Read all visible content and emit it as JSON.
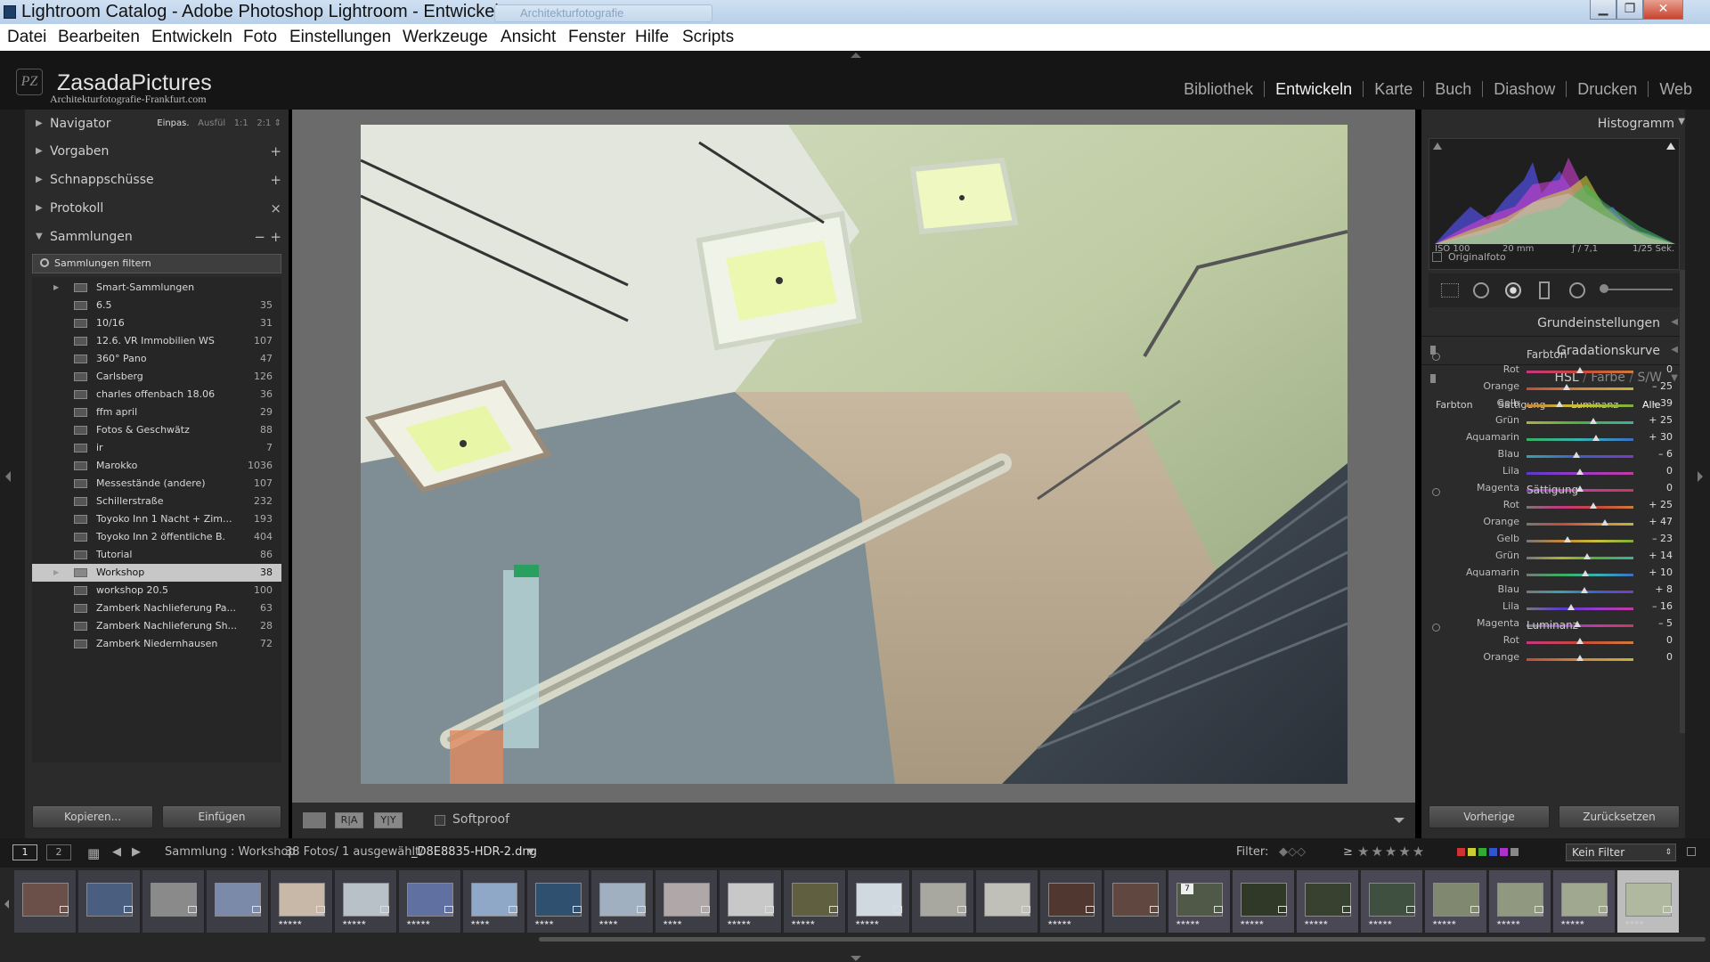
{
  "window": {
    "title": "Lightroom Catalog - Adobe Photoshop Lightroom - Entwickeln",
    "ghost_tab": "Architekturfotografie",
    "minimize": "▁",
    "maximize": "❐",
    "close": "✕"
  },
  "menu": [
    "Datei",
    "Bearbeiten",
    "Entwickeln",
    "Foto",
    "Einstellungen",
    "Werkzeuge",
    "Ansicht",
    "Fenster",
    "Hilfe",
    "Scripts"
  ],
  "brand": {
    "logo": "PZ",
    "name": "ZasadaPictures",
    "subtitle": "Architekturfotografie-Frankfurt.com"
  },
  "modules": [
    {
      "label": "Bibliothek",
      "active": false
    },
    {
      "label": "Entwickeln",
      "active": true
    },
    {
      "label": "Karte",
      "active": false
    },
    {
      "label": "Buch",
      "active": false
    },
    {
      "label": "Diashow",
      "active": false
    },
    {
      "label": "Drucken",
      "active": false
    },
    {
      "label": "Web",
      "active": false
    }
  ],
  "left": {
    "navigator": {
      "label": "Navigator",
      "opt_fit": "Einpas.",
      "opt_fill": "Ausfül",
      "opt_11": "1:1",
      "opt_21": "2:1",
      "arrows": "⇕"
    },
    "presets": {
      "label": "Vorgaben",
      "action": "+"
    },
    "snapshots": {
      "label": "Schnappschüsse",
      "action": "+"
    },
    "history": {
      "label": "Protokoll",
      "action": "×"
    },
    "collections": {
      "label": "Sammlungen",
      "action_minus": "−",
      "action_plus": "+",
      "filter_placeholder": "Sammlungen filtern"
    },
    "collection_items": [
      {
        "name": "Smart-Sammlungen",
        "count": "",
        "selected": false,
        "expand": "▶"
      },
      {
        "name": "6.5",
        "count": "35",
        "selected": false,
        "expand": ""
      },
      {
        "name": "10/16",
        "count": "31",
        "selected": false,
        "expand": ""
      },
      {
        "name": "12.6. VR Immobilien WS",
        "count": "107",
        "selected": false,
        "expand": ""
      },
      {
        "name": "360° Pano",
        "count": "47",
        "selected": false,
        "expand": ""
      },
      {
        "name": "Carlsberg",
        "count": "126",
        "selected": false,
        "expand": ""
      },
      {
        "name": "charles offenbach 18.06",
        "count": "36",
        "selected": false,
        "expand": ""
      },
      {
        "name": "ffm april",
        "count": "29",
        "selected": false,
        "expand": ""
      },
      {
        "name": "Fotos & Geschwätz",
        "count": "88",
        "selected": false,
        "expand": ""
      },
      {
        "name": "ir",
        "count": "7",
        "selected": false,
        "expand": ""
      },
      {
        "name": "Marokko",
        "count": "1036",
        "selected": false,
        "expand": ""
      },
      {
        "name": "Messestände (andere)",
        "count": "107",
        "selected": false,
        "expand": ""
      },
      {
        "name": "Schillerstraße",
        "count": "232",
        "selected": false,
        "expand": ""
      },
      {
        "name": "Toyoko Inn 1 Nacht + Zim...",
        "count": "193",
        "selected": false,
        "expand": ""
      },
      {
        "name": "Toyoko Inn 2 öffentliche B.",
        "count": "404",
        "selected": false,
        "expand": ""
      },
      {
        "name": "Tutorial",
        "count": "86",
        "selected": false,
        "expand": ""
      },
      {
        "name": "Workshop",
        "count": "38",
        "selected": true,
        "expand": "▶"
      },
      {
        "name": "workshop 20.5",
        "count": "100",
        "selected": false,
        "expand": ""
      },
      {
        "name": "Zamberk Nachlieferung Pa...",
        "count": "63",
        "selected": false,
        "expand": ""
      },
      {
        "name": "Zamberk Nachlieferung Sh...",
        "count": "28",
        "selected": false,
        "expand": ""
      },
      {
        "name": "Zamberk Niedernhausen",
        "count": "72",
        "selected": false,
        "expand": ""
      }
    ],
    "btn_copy": "Kopieren...",
    "btn_paste": "Einfügen"
  },
  "toolbar": {
    "softproof": "Softproof",
    "ry": "R|A",
    "yy": "Y|Y"
  },
  "right": {
    "histogram": {
      "label": "Histogramm",
      "iso": "ISO 100",
      "focal": "20 mm",
      "aperture": "ƒ / 7,1",
      "shutter": "1/25 Sek.",
      "original": "Originalfoto"
    },
    "basic": "Grundeinstellungen",
    "tonecurve": "Gradationskurve",
    "hsl": {
      "hsl": "HSL",
      "sep1": "/",
      "color": "Farbe",
      "sep2": "/",
      "bw": "S/W"
    },
    "tabs": [
      "Farbton",
      "Sättigung",
      "Luminanz",
      "Alle"
    ],
    "groups": [
      {
        "title": "Farbton",
        "rows": [
          {
            "label": "Rot",
            "value": "0",
            "pos": 0.5
          },
          {
            "label": "Orange",
            "value": "– 25",
            "pos": 0.375
          },
          {
            "label": "Gelb",
            "value": "– 39",
            "pos": 0.305
          },
          {
            "label": "Grün",
            "value": "+ 25",
            "pos": 0.625
          },
          {
            "label": "Aquamarin",
            "value": "+ 30",
            "pos": 0.65
          },
          {
            "label": "Blau",
            "value": "– 6",
            "pos": 0.47
          },
          {
            "label": "Lila",
            "value": "0",
            "pos": 0.5
          },
          {
            "label": "Magenta",
            "value": "0",
            "pos": 0.5
          }
        ]
      },
      {
        "title": "Sättigung",
        "rows": [
          {
            "label": "Rot",
            "value": "+ 25",
            "pos": 0.625
          },
          {
            "label": "Orange",
            "value": "+ 47",
            "pos": 0.735
          },
          {
            "label": "Gelb",
            "value": "– 23",
            "pos": 0.385
          },
          {
            "label": "Grün",
            "value": "+ 14",
            "pos": 0.57
          },
          {
            "label": "Aquamarin",
            "value": "+ 10",
            "pos": 0.55
          },
          {
            "label": "Blau",
            "value": "+ 8",
            "pos": 0.54
          },
          {
            "label": "Lila",
            "value": "– 16",
            "pos": 0.42
          },
          {
            "label": "Magenta",
            "value": "– 5",
            "pos": 0.475
          }
        ]
      },
      {
        "title": "Luminanz",
        "rows": [
          {
            "label": "Rot",
            "value": "0",
            "pos": 0.5
          },
          {
            "label": "Orange",
            "value": "0",
            "pos": 0.5
          }
        ]
      }
    ],
    "btn_prev": "Vorherige",
    "btn_reset": "Zurücksetzen"
  },
  "filmbar": {
    "view1": "1",
    "view2": "2",
    "source": "Sammlung : Workshop",
    "count": "38 Fotos/ 1 ausgewählt/",
    "file": "_D8E8835-HDR-2.dng",
    "filter_label": "Filter:",
    "gte": "≥",
    "stars": "★★★★★",
    "filter_select": "Kein Filter"
  },
  "filmstrip": [
    {
      "stars": "",
      "tone": "#6a5048"
    },
    {
      "stars": "",
      "tone": "#4a5f80"
    },
    {
      "stars": "",
      "tone": "#8a8a8a"
    },
    {
      "stars": "",
      "tone": "#7a8aa8"
    },
    {
      "stars": "★★★★★",
      "tone": "#c8b8a8"
    },
    {
      "stars": "★★★★★",
      "tone": "#b8c0c8"
    },
    {
      "stars": "★★★★★",
      "tone": "#6070a0"
    },
    {
      "stars": "★★★★",
      "tone": "#90a8c8"
    },
    {
      "stars": "★★★★",
      "tone": "#305070"
    },
    {
      "stars": "★★★★",
      "tone": "#a0b0c0"
    },
    {
      "stars": "★★★★",
      "tone": "#b0a8a8"
    },
    {
      "stars": "★★★★★",
      "tone": "#c8c8c8"
    },
    {
      "stars": "★★★★★",
      "tone": "#606040"
    },
    {
      "stars": "★★★★★",
      "tone": "#d0d8e0"
    },
    {
      "stars": "",
      "tone": "#a8a8a0"
    },
    {
      "stars": "",
      "tone": "#c0c0b8"
    },
    {
      "stars": "★★★★★",
      "tone": "#503830"
    },
    {
      "stars": "",
      "tone": "#604840"
    },
    {
      "stars": "★★★★★",
      "tone": "#505848",
      "num": "7"
    },
    {
      "stars": "★★★★★",
      "tone": "#303828"
    },
    {
      "stars": "★★★★★",
      "tone": "#384030"
    },
    {
      "stars": "★★★★★",
      "tone": "#405040"
    },
    {
      "stars": "★★★★★",
      "tone": "#808870"
    },
    {
      "stars": "★★★★★",
      "tone": "#909880"
    },
    {
      "stars": "★★★★★",
      "tone": "#a0a890"
    },
    {
      "stars": "★★★★",
      "tone": "#b0b8a0"
    }
  ]
}
